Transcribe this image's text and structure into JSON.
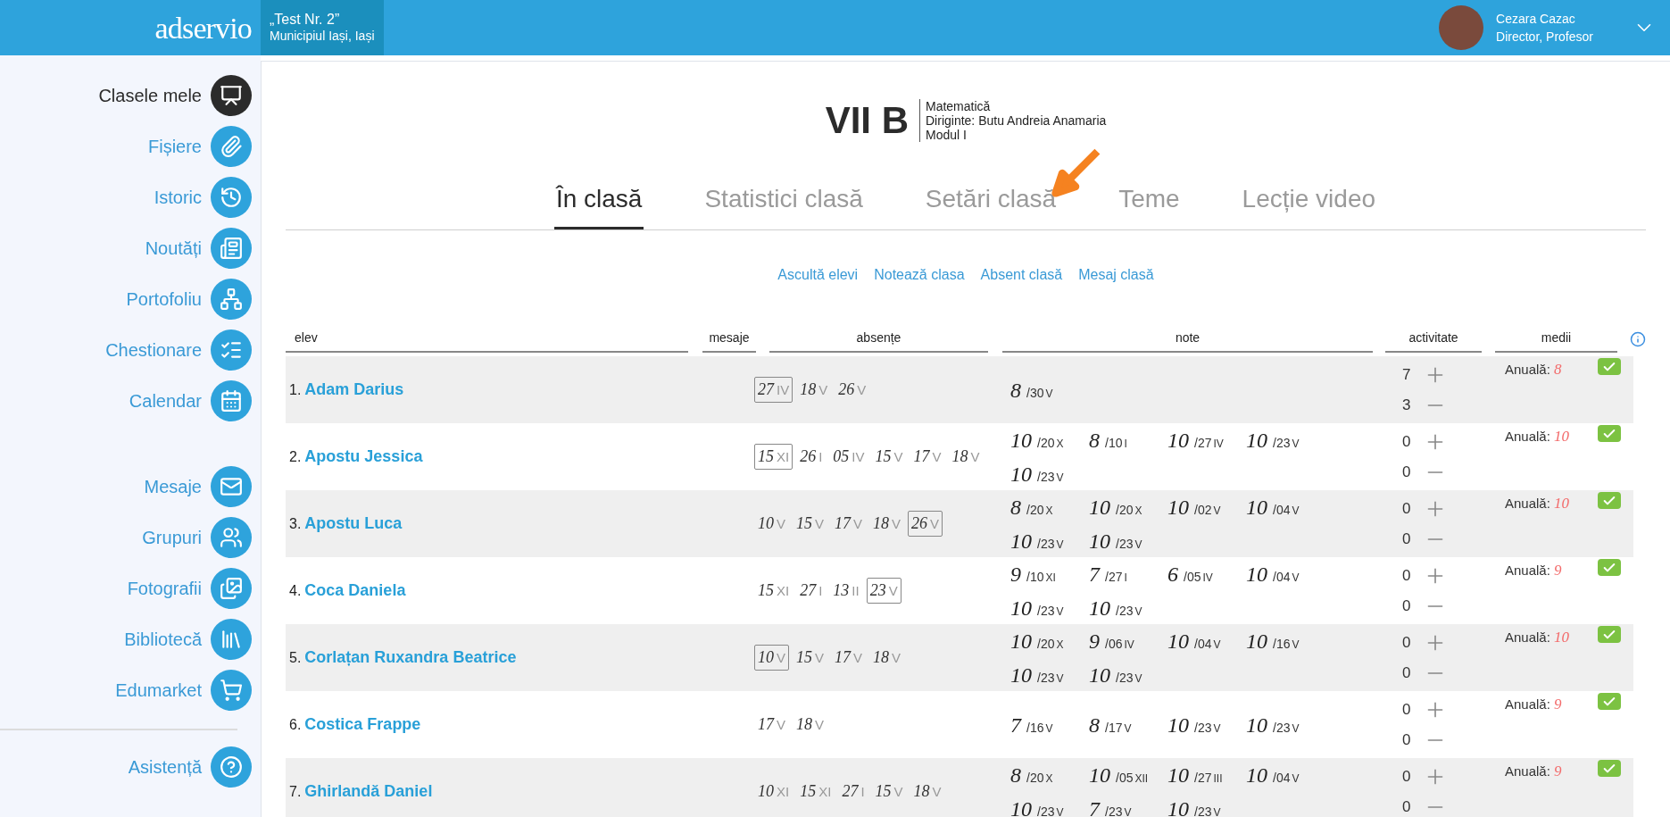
{
  "header": {
    "logo": "adservio",
    "school": {
      "name": "„Test Nr. 2”",
      "location": "Municipiul Iași, Iași"
    },
    "user": {
      "name": "Cezara Cazac",
      "role": "Director, Profesor"
    }
  },
  "sidebar": {
    "groups": [
      [
        {
          "label": "Clasele mele",
          "selected": true
        },
        {
          "label": "Fișiere",
          "selected": false
        },
        {
          "label": "Istoric",
          "selected": false
        },
        {
          "label": "Noutăți",
          "selected": false
        },
        {
          "label": "Portofoliu",
          "selected": false
        },
        {
          "label": "Chestionare",
          "selected": false
        },
        {
          "label": "Calendar",
          "selected": false
        }
      ],
      [
        {
          "label": "Mesaje",
          "selected": false
        },
        {
          "label": "Grupuri",
          "selected": false
        },
        {
          "label": "Fotografii",
          "selected": false
        },
        {
          "label": "Bibliotecă",
          "selected": false
        },
        {
          "label": "Edumarket",
          "selected": false
        }
      ],
      [
        {
          "label": "Asistență",
          "selected": false
        }
      ]
    ]
  },
  "class": {
    "name": "VII B",
    "details": [
      "Matematică",
      "Diriginte: Butu Andreia Anamaria",
      "Modul I"
    ]
  },
  "tabs": [
    {
      "label": "În clasă",
      "selected": true
    },
    {
      "label": "Statistici clasă",
      "selected": false
    },
    {
      "label": "Setări clasă",
      "selected": false
    },
    {
      "label": "Teme",
      "selected": false
    },
    {
      "label": "Lecție video",
      "selected": false
    }
  ],
  "actions": [
    "Ascultă elevi",
    "Notează clasa",
    "Absent clasă",
    "Mesaj clasă"
  ],
  "table": {
    "columns": [
      "elev",
      "mesaje",
      "absențe",
      "note",
      "activitate",
      "medii"
    ],
    "rows": [
      {
        "number": "1.",
        "name": "Adam Darius",
        "absences": [
          {
            "day": "27",
            "month": "IV",
            "boxed": true
          },
          {
            "day": "18",
            "month": "V",
            "boxed": false
          },
          {
            "day": "26",
            "month": "V",
            "boxed": false
          }
        ],
        "grades": [
          {
            "grade": "8",
            "day": "/30",
            "month": "V"
          }
        ],
        "plus": "7",
        "minus": "3",
        "average_label": "Anuală:",
        "average": "8",
        "confirmed": true
      },
      {
        "number": "2.",
        "name": "Apostu Jessica",
        "absences": [
          {
            "day": "15",
            "month": "XI",
            "boxed": true
          },
          {
            "day": "26",
            "month": "I",
            "boxed": false
          },
          {
            "day": "05",
            "month": "IV",
            "boxed": false
          },
          {
            "day": "15",
            "month": "V",
            "boxed": false
          },
          {
            "day": "17",
            "month": "V",
            "boxed": false
          },
          {
            "day": "18",
            "month": "V",
            "boxed": false
          }
        ],
        "grades": [
          {
            "grade": "10",
            "day": "/20",
            "month": "X"
          },
          {
            "grade": "8",
            "day": "/10",
            "month": "I"
          },
          {
            "grade": "10",
            "day": "/27",
            "month": "IV"
          },
          {
            "grade": "10",
            "day": "/23",
            "month": "V"
          },
          {
            "grade": "10",
            "day": "/23",
            "month": "V"
          }
        ],
        "plus": "0",
        "minus": "0",
        "average_label": "Anuală:",
        "average": "10",
        "confirmed": true
      },
      {
        "number": "3.",
        "name": "Apostu Luca",
        "absences": [
          {
            "day": "10",
            "month": "V",
            "boxed": false
          },
          {
            "day": "15",
            "month": "V",
            "boxed": false
          },
          {
            "day": "17",
            "month": "V",
            "boxed": false
          },
          {
            "day": "18",
            "month": "V",
            "boxed": false
          },
          {
            "day": "26",
            "month": "V",
            "boxed": true
          }
        ],
        "grades": [
          {
            "grade": "8",
            "day": "/20",
            "month": "X"
          },
          {
            "grade": "10",
            "day": "/20",
            "month": "X"
          },
          {
            "grade": "10",
            "day": "/02",
            "month": "V"
          },
          {
            "grade": "10",
            "day": "/04",
            "month": "V"
          },
          {
            "grade": "10",
            "day": "/23",
            "month": "V"
          },
          {
            "grade": "10",
            "day": "/23",
            "month": "V"
          }
        ],
        "plus": "0",
        "minus": "0",
        "average_label": "Anuală:",
        "average": "10",
        "confirmed": true
      },
      {
        "number": "4.",
        "name": "Coca Daniela",
        "absences": [
          {
            "day": "15",
            "month": "XI",
            "boxed": false
          },
          {
            "day": "27",
            "month": "I",
            "boxed": false
          },
          {
            "day": "13",
            "month": "II",
            "boxed": false
          },
          {
            "day": "23",
            "month": "V",
            "boxed": true
          }
        ],
        "grades": [
          {
            "grade": "9",
            "day": "/10",
            "month": "XI"
          },
          {
            "grade": "7",
            "day": "/27",
            "month": "I"
          },
          {
            "grade": "6",
            "day": "/05",
            "month": "IV"
          },
          {
            "grade": "10",
            "day": "/04",
            "month": "V"
          },
          {
            "grade": "10",
            "day": "/23",
            "month": "V"
          },
          {
            "grade": "10",
            "day": "/23",
            "month": "V"
          }
        ],
        "plus": "0",
        "minus": "0",
        "average_label": "Anuală:",
        "average": "9",
        "confirmed": true
      },
      {
        "number": "5.",
        "name": "Corlațan Ruxandra Beatrice",
        "absences": [
          {
            "day": "10",
            "month": "V",
            "boxed": true
          },
          {
            "day": "15",
            "month": "V",
            "boxed": false
          },
          {
            "day": "17",
            "month": "V",
            "boxed": false
          },
          {
            "day": "18",
            "month": "V",
            "boxed": false
          }
        ],
        "grades": [
          {
            "grade": "10",
            "day": "/20",
            "month": "X"
          },
          {
            "grade": "9",
            "day": "/06",
            "month": "IV"
          },
          {
            "grade": "10",
            "day": "/04",
            "month": "V"
          },
          {
            "grade": "10",
            "day": "/16",
            "month": "V"
          },
          {
            "grade": "10",
            "day": "/23",
            "month": "V"
          },
          {
            "grade": "10",
            "day": "/23",
            "month": "V"
          }
        ],
        "plus": "0",
        "minus": "0",
        "average_label": "Anuală:",
        "average": "10",
        "confirmed": true
      },
      {
        "number": "6.",
        "name": "Costica Frappe",
        "absences": [
          {
            "day": "17",
            "month": "V",
            "boxed": false
          },
          {
            "day": "18",
            "month": "V",
            "boxed": false
          }
        ],
        "grades": [
          {
            "grade": "7",
            "day": "/16",
            "month": "V"
          },
          {
            "grade": "8",
            "day": "/17",
            "month": "V"
          },
          {
            "grade": "10",
            "day": "/23",
            "month": "V"
          },
          {
            "grade": "10",
            "day": "/23",
            "month": "V"
          }
        ],
        "plus": "0",
        "minus": "0",
        "average_label": "Anuală:",
        "average": "9",
        "confirmed": true
      },
      {
        "number": "7.",
        "name": "Ghirlandă Daniel",
        "absences": [
          {
            "day": "10",
            "month": "XI",
            "boxed": false
          },
          {
            "day": "15",
            "month": "XI",
            "boxed": false
          },
          {
            "day": "27",
            "month": "I",
            "boxed": false
          },
          {
            "day": "15",
            "month": "V",
            "boxed": false
          },
          {
            "day": "18",
            "month": "V",
            "boxed": false
          }
        ],
        "grades": [
          {
            "grade": "8",
            "day": "/20",
            "month": "X"
          },
          {
            "grade": "10",
            "day": "/05",
            "month": "XII"
          },
          {
            "grade": "10",
            "day": "/27",
            "month": "III"
          },
          {
            "grade": "10",
            "day": "/04",
            "month": "V"
          },
          {
            "grade": "10",
            "day": "/23",
            "month": "V"
          },
          {
            "grade": "7",
            "day": "/23",
            "month": "V"
          },
          {
            "grade": "10",
            "day": "/23",
            "month": "V"
          }
        ],
        "plus": "0",
        "minus": "0",
        "average_label": "Anuală:",
        "average": "9",
        "confirmed": true
      }
    ]
  }
}
